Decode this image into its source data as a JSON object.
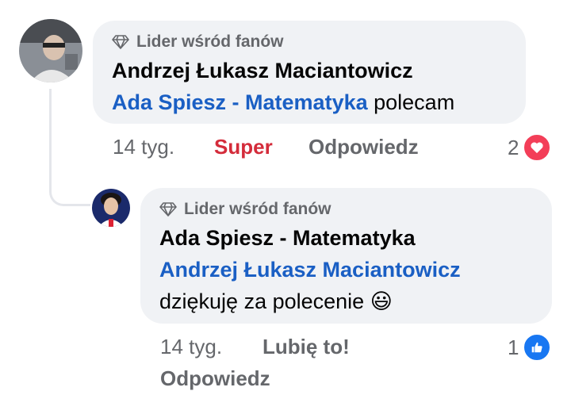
{
  "comment": {
    "badge": "Lider wśród fanów",
    "author": "Andrzej Łukasz Maciantowicz",
    "mention": "Ada Spiesz - Matematyka",
    "text": " polecam",
    "time": "14 tyg.",
    "reaction_label": "Super",
    "reply_label": "Odpowiedz",
    "reaction_count": "2",
    "reaction_icon": "heart-icon",
    "reaction_color": "#f33e58"
  },
  "reply": {
    "badge": "Lider wśród fanów",
    "author": "Ada Spiesz - Matematyka",
    "mention": "Andrzej Łukasz Maciantowicz",
    "text": "dziękuję za polecenie ",
    "emoji": "😃",
    "time": "14 tyg.",
    "like_label": "Lubię to!",
    "reply_label": "Odpowiedz",
    "reaction_count": "1",
    "reaction_icon": "thumbs-up-icon",
    "reaction_color": "#1877f2"
  }
}
